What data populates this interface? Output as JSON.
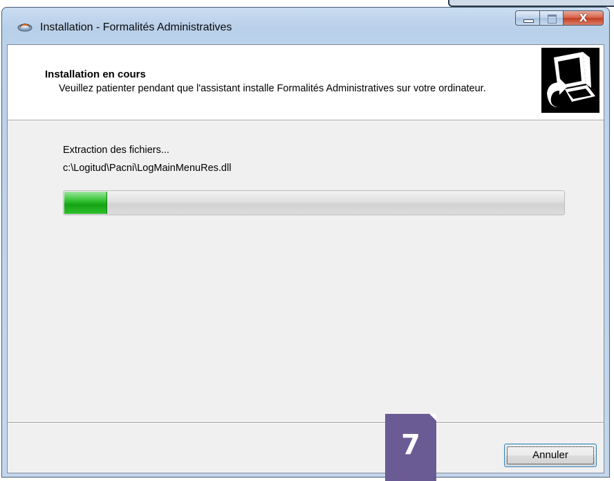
{
  "window": {
    "title": "Installation - Formalités Administratives",
    "close_glyph": "X"
  },
  "header": {
    "title": "Installation en cours",
    "description": "Veuillez patienter pendant que l'assistant installe Formalités Administratives sur votre ordinateur."
  },
  "body": {
    "status": "Extraction des fichiers...",
    "current_file": "c:\\Logitud\\Pacni\\LogMainMenuRes.dll",
    "progress_fraction": 0.085
  },
  "buttons": {
    "cancel_label": "Annuler"
  },
  "step_badge": {
    "number": "7",
    "color": "#6b5b95"
  },
  "icons": {
    "app": "installer-app-icon",
    "header_image": "computer-install-icon"
  }
}
